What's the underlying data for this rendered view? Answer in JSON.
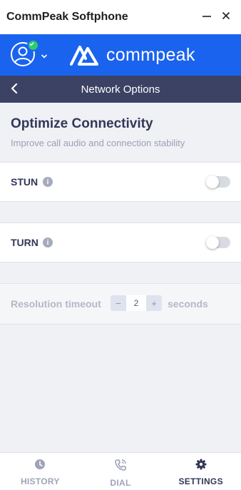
{
  "window": {
    "title": "CommPeak Softphone",
    "minimize_icon": "minimize-icon",
    "close_icon": "close-icon"
  },
  "brand": {
    "logo_text": "commpeak",
    "accent": "#1a63ef",
    "presence_color": "#2ecc71"
  },
  "header": {
    "title": "Network Options",
    "back_icon": "chevron-left-icon"
  },
  "section": {
    "title": "Optimize Connectivity",
    "description": "Improve call audio and connection stability"
  },
  "options": [
    {
      "label": "STUN",
      "enabled": false,
      "info_icon": "info-icon"
    },
    {
      "label": "TURN",
      "enabled": false,
      "info_icon": "info-icon"
    }
  ],
  "timeout": {
    "label": "Resolution timeout",
    "minus": "−",
    "value": "2",
    "plus": "+",
    "unit": "seconds"
  },
  "tabs": [
    {
      "label": "HISTORY",
      "icon": "clock-icon",
      "active": false
    },
    {
      "label": "DIAL",
      "icon": "phone-icon",
      "active": false
    },
    {
      "label": "SETTINGS",
      "icon": "gear-icon",
      "active": true
    }
  ],
  "colors": {
    "navbar": "#3b4263",
    "text_dark": "#323858",
    "text_muted": "#9aa0b4"
  }
}
